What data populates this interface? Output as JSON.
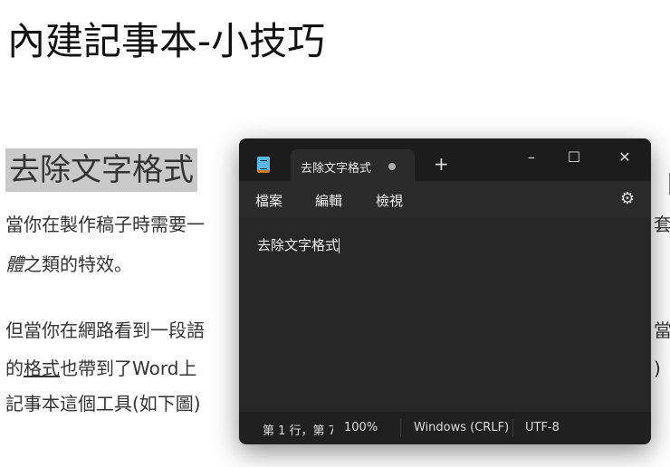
{
  "page": {
    "title": "內建記事本-小技巧",
    "heading": "去除文字格式",
    "p1_line1": "當你在製作稿子時需要一",
    "p1_line1_right": "套",
    "p1_line2_italic": "體",
    "p1_line2": "之類的特效。",
    "p2_line1": "但當你在網路看到一段語",
    "p2_line1_right": "當",
    "p2_line2_pre": "的",
    "p2_line2_link": "格式",
    "p2_line2_post": "也帶到了Word上",
    "p2_line2_right": ")",
    "p2_line3": "記事本這個工具(如下圖)",
    "heading_right": "【"
  },
  "notepad": {
    "tab_title": "去除文字格式",
    "new_tab": "+",
    "minimize": "–",
    "maximize": "☐",
    "close": "✕",
    "menu": [
      "檔案",
      "編輯",
      "檢視"
    ],
    "settings_icon": "⚙",
    "content": "去除文字格式",
    "status": {
      "position": "第 1 行，第 7",
      "zoom": "100%",
      "line_ending": "Windows (CRLF)",
      "encoding": "UTF-8"
    }
  }
}
